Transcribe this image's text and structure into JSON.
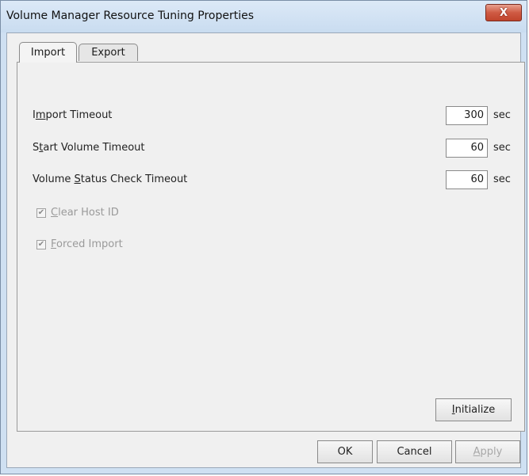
{
  "window": {
    "title": "Volume Manager Resource Tuning Properties",
    "close_label": "X"
  },
  "tabs": [
    {
      "label": "Import"
    },
    {
      "label": "Export"
    }
  ],
  "import_tab": {
    "fields": [
      {
        "label_pre": "I",
        "label_mnemonic": "m",
        "label_post": "port Timeout",
        "value": "300",
        "unit": "sec"
      },
      {
        "label_pre": "S",
        "label_mnemonic": "t",
        "label_post": "art Volume Timeout",
        "value": "60",
        "unit": "sec"
      },
      {
        "label_pre": "Volume ",
        "label_mnemonic": "S",
        "label_post": "tatus Check Timeout",
        "value": "60",
        "unit": "sec"
      }
    ],
    "checkboxes": [
      {
        "mnemonic": "C",
        "label_rest": "lear Host ID",
        "checked": true,
        "enabled": false
      },
      {
        "mnemonic": "F",
        "label_rest": "orced Import",
        "checked": true,
        "enabled": false
      }
    ],
    "initialize": {
      "mnemonic": "I",
      "rest": "nitialize"
    }
  },
  "footer": {
    "ok_label": "OK",
    "cancel_label": "Cancel",
    "apply_mnemonic": "A",
    "apply_rest": "pply"
  }
}
